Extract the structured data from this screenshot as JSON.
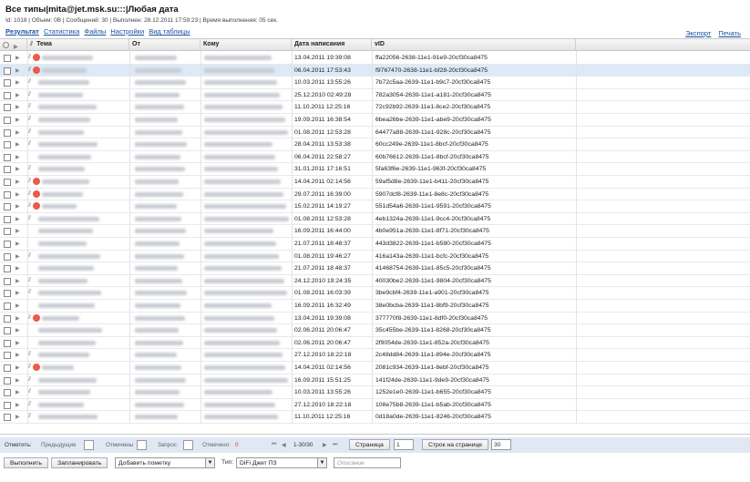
{
  "header": {
    "title": "Все типы|mita@jet.msk.su:::|Любая дата",
    "meta": "Id: 1018 | Объем: 0B | Сообщений: 30 | Выполнен: 28.12.2011 17:59:23 | Время выполнения: 05 сек.",
    "links": [
      "Результат",
      "Статистика",
      "Файлы",
      "Настройки",
      "Вид таблицы"
    ],
    "right_links": [
      "Экспорт",
      "Печать"
    ]
  },
  "columns": {
    "tema": "Тема",
    "ot": "От",
    "komu": "Кому",
    "date": "Дата написания",
    "vid": "vID"
  },
  "rows": [
    {
      "flag": true,
      "clip": true,
      "date": "13.04.2011 19:39:08",
      "vid": "ffa22056-2638-11e1-91e9-20cf30ca8475"
    },
    {
      "flag": true,
      "clip": true,
      "date": "06.04.2011 17:53:43",
      "vid": "f9767470-2638-11e1-bf28-20cf30ca8475",
      "sel": true
    },
    {
      "flag": false,
      "clip": true,
      "date": "10.03.2011 13:55:26",
      "vid": "7b72c5aa-2639-11e1-b9c7-20cf30ca8475"
    },
    {
      "flag": false,
      "clip": true,
      "date": "25.12.2010 02:49:28",
      "vid": "782a3054-2639-11e1-a181-20cf30ca8475"
    },
    {
      "flag": false,
      "clip": true,
      "date": "11.10.2011 12:25:16",
      "vid": "72c92b92-2639-11e1-8ce2-20cf30ca8475"
    },
    {
      "flag": false,
      "clip": true,
      "date": "19.09.2011 16:38:54",
      "vid": "6bea26be-2639-11e1-abe9-20cf30ca8475"
    },
    {
      "flag": false,
      "clip": true,
      "date": "01.08.2011 12:53:28",
      "vid": "64477a88-2639-11e1-928c-20cf30ca8475"
    },
    {
      "flag": false,
      "clip": true,
      "date": "28.04.2011 13:53:38",
      "vid": "60cc249e-2639-11e1-8bcf-20cf30ca8475"
    },
    {
      "flag": false,
      "clip": false,
      "date": "06.04.2011 22:58:27",
      "vid": "60b76612-2639-11e1-8bcf-20cf30ca8475"
    },
    {
      "flag": false,
      "clip": true,
      "date": "31.01.2011 17:16:51",
      "vid": "5fa63f6e-2639-11e1-963f-20cf30ca8475"
    },
    {
      "flag": true,
      "clip": true,
      "date": "14.04.2011 02:14:56",
      "vid": "59af5d8e-2639-11e1-b411-20cf30ca8475"
    },
    {
      "flag": true,
      "clip": true,
      "date": "29.07.2011 16:39:00",
      "vid": "5907dcf8-2639-11e1-8e8c-20cf30ca8475"
    },
    {
      "flag": true,
      "clip": true,
      "date": "15.02.2011 14:19:27",
      "vid": "551d54a6-2639-11e1-9591-20cf30ca8475"
    },
    {
      "flag": false,
      "clip": true,
      "date": "01.08.2011 12:53:28",
      "vid": "4eb1324a-2639-11e1-9cc4-20cf30ca8475"
    },
    {
      "flag": false,
      "clip": false,
      "date": "16.09.2011 16:44:00",
      "vid": "4b0e951a-2639-11e1-8f71-20cf30ca8475"
    },
    {
      "flag": false,
      "clip": false,
      "date": "21.07.2011 18:48:37",
      "vid": "443d3822-2639-11e1-b580-20cf30ca8475"
    },
    {
      "flag": false,
      "clip": true,
      "date": "01.08.2011 19:46:27",
      "vid": "416a143a-2639-11e1-bcfc-20cf30ca8475"
    },
    {
      "flag": false,
      "clip": false,
      "date": "21.07.2011 18:48:37",
      "vid": "41468754-2639-11e1-85c5-20cf30ca8475"
    },
    {
      "flag": false,
      "clip": true,
      "date": "24.12.2010 19:24:35",
      "vid": "40030be2-2639-11e1-9804-20cf30ca8475"
    },
    {
      "flag": false,
      "clip": true,
      "date": "01.08.2011 16:03:39",
      "vid": "3be9cbf4-2639-11e1-a901-20cf30ca8475"
    },
    {
      "flag": false,
      "clip": false,
      "date": "16.09.2011 16:32:49",
      "vid": "38e0bcba-2639-11e1-8bf9-20cf30ca8475"
    },
    {
      "flag": true,
      "clip": true,
      "date": "13.04.2011 19:39:08",
      "vid": "377770f8-2639-11e1-8df0-20cf30ca8475"
    },
    {
      "flag": false,
      "clip": false,
      "date": "02.06.2011 20:06:47",
      "vid": "35c455be-2639-11e1-8268-20cf30ca8475"
    },
    {
      "flag": false,
      "clip": false,
      "date": "02.06.2011 20:06:47",
      "vid": "2f9054de-2639-11e1-852a-20cf30ca8475"
    },
    {
      "flag": false,
      "clip": true,
      "date": "27.12.2010 18:22:18",
      "vid": "2c48dd84-2639-11e1-894e-20cf30ca8475"
    },
    {
      "flag": true,
      "clip": true,
      "date": "14.04.2011 02:14:56",
      "vid": "2081c934-2639-11e1-8ebf-20cf30ca8475"
    },
    {
      "flag": false,
      "clip": true,
      "date": "16.09.2011 15:51:25",
      "vid": "141f24de-2639-11e1-9de9-20cf30ca8475"
    },
    {
      "flag": false,
      "clip": true,
      "date": "10.03.2011 13:55:26",
      "vid": "1252e1e0-2639-11e1-b655-20cf30ca8475"
    },
    {
      "flag": false,
      "clip": true,
      "date": "27.12.2010 18:22:18",
      "vid": "108e75b8-2639-11e1-b5ab-20cf30ca8475"
    },
    {
      "flag": false,
      "clip": true,
      "date": "11.10.2011 12:25:16",
      "vid": "0d18a0de-2639-11e1-8246-20cf30ca8475"
    }
  ],
  "pager": {
    "mark_label": "Отметить:",
    "prev_label": "Предыдущие",
    "checked_label": "Отмечены",
    "query_label": "Запрос",
    "marked_label": "Отмечено:",
    "marked_count": "0",
    "range": "1-30/30",
    "page_button": "Страница",
    "page_value": "1",
    "per_page_button": "Строк на странице",
    "per_page_value": "30"
  },
  "footer": {
    "run_button": "Выполнить",
    "schedule_button": "Запланировать",
    "add_mark_select": "Добавить пометку",
    "type_label": "Тип:",
    "type_select": "DiFi Джет ПЗ",
    "description_placeholder": "Описание"
  },
  "colors": {
    "link": "#1a4fa3",
    "flag": "#ec5a4c",
    "selected_row": "#dce9f7",
    "pager_bg": "#dfe8f3"
  }
}
